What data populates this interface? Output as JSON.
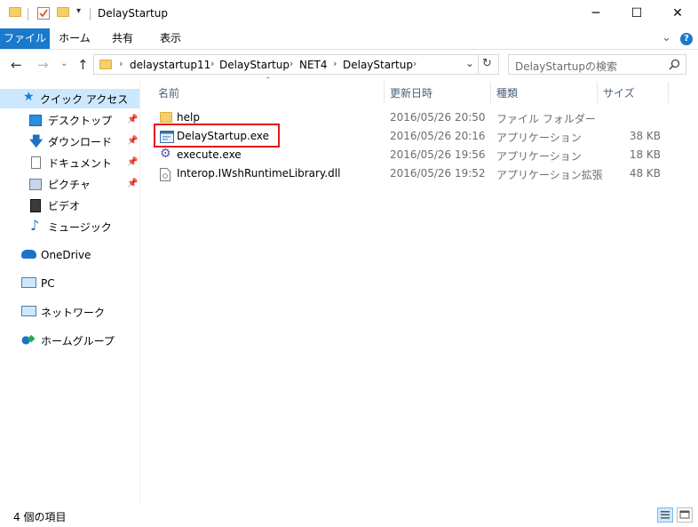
{
  "window": {
    "title": "DelayStartup",
    "minimize": "─",
    "maximize": "☐",
    "close": "✕"
  },
  "ribbon": {
    "tabs": [
      "ファイル",
      "ホーム",
      "共有",
      "表示"
    ],
    "collapse": "⌄",
    "help": "?"
  },
  "address": {
    "crumbs": [
      "delaystartup11",
      "DelayStartup",
      "NET4",
      "DelayStartup"
    ],
    "dropdown": "⌄",
    "refresh": "↻"
  },
  "search": {
    "placeholder": "DelayStartupの検索",
    "icon": "search-icon"
  },
  "nav": {
    "quick_access": "クイック アクセス",
    "items": [
      "デスクトップ",
      "ダウンロード",
      "ドキュメント",
      "ピクチャ",
      "ビデオ",
      "ミュージック"
    ],
    "onedrive": "OneDrive",
    "pc": "PC",
    "network": "ネットワーク",
    "homegroup": "ホームグループ"
  },
  "columns": {
    "name": "名前",
    "date": "更新日時",
    "type": "種類",
    "size": "サイズ"
  },
  "files": [
    {
      "name": "help",
      "date": "2016/05/26 20:50",
      "type": "ファイル フォルダー",
      "size": "",
      "icon": "folder-icon"
    },
    {
      "name": "DelayStartup.exe",
      "date": "2016/05/26 20:16",
      "type": "アプリケーション",
      "size": "38 KB",
      "icon": "application-window-icon"
    },
    {
      "name": "execute.exe",
      "date": "2016/05/26 19:56",
      "type": "アプリケーション",
      "size": "18 KB",
      "icon": "gear-app-icon"
    },
    {
      "name": "Interop.IWshRuntimeLibrary.dll",
      "date": "2016/05/26 19:52",
      "type": "アプリケーション拡張",
      "size": "48 KB",
      "icon": "dll-file-icon"
    }
  ],
  "status": {
    "count_text": "4 個の項目"
  },
  "colors": {
    "accent": "#1979ca",
    "selection": "#cce8ff",
    "highlight_box": "#e01a1a",
    "folder": "#f4cf6a"
  }
}
